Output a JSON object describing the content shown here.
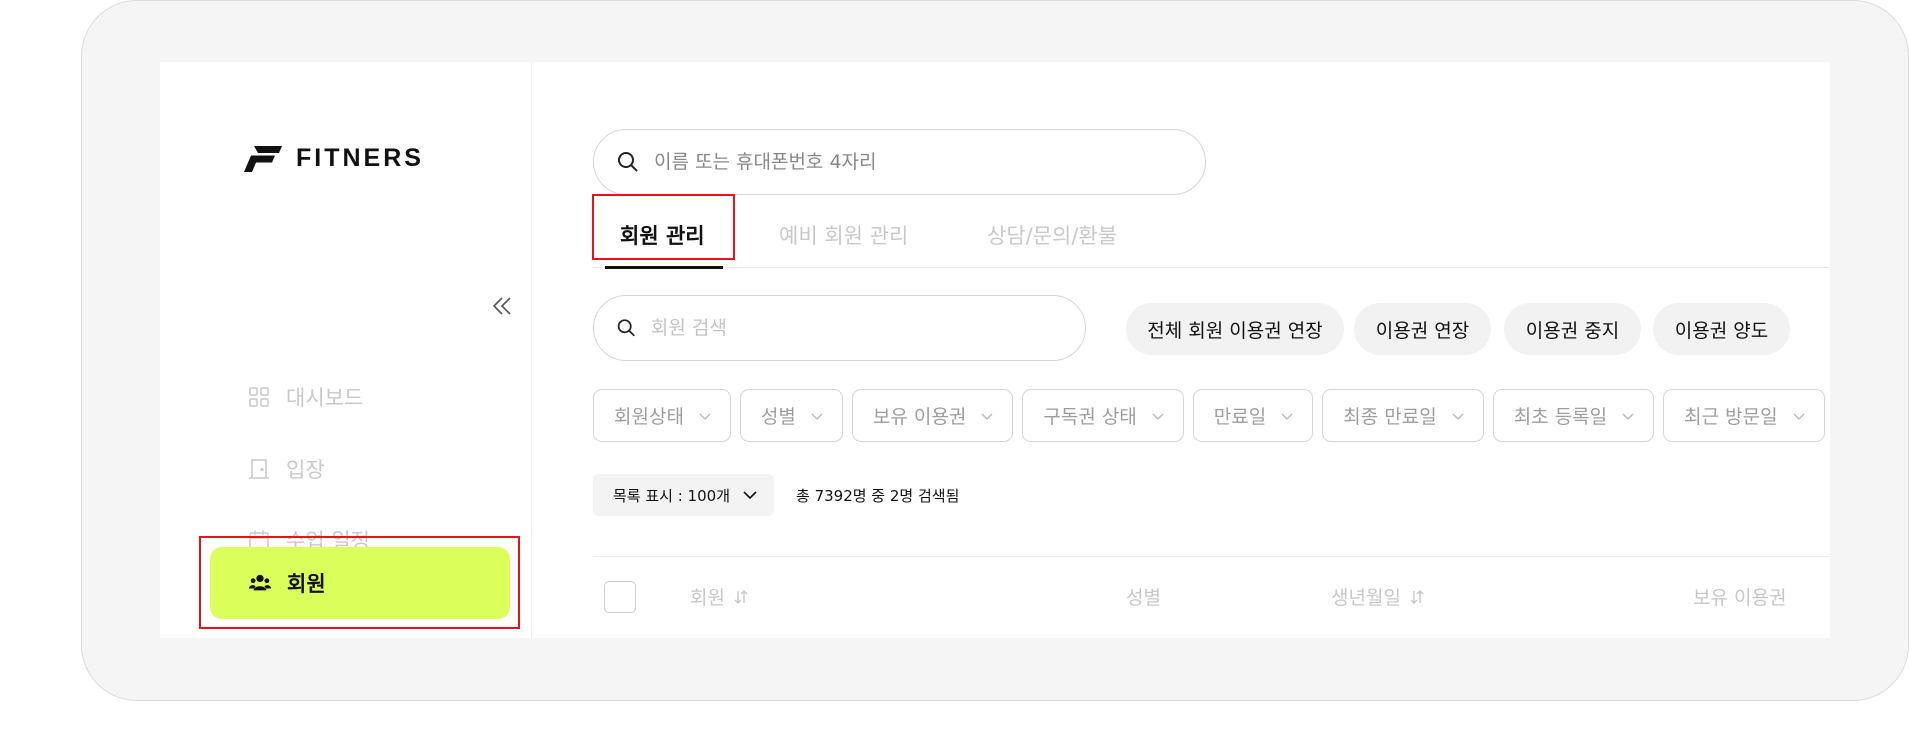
{
  "brand": {
    "name": "FITNERS"
  },
  "sidebar": {
    "items": [
      {
        "label": "대시보드",
        "icon": "grid-icon"
      },
      {
        "label": "입장",
        "icon": "door-icon"
      },
      {
        "label": "수업 일정",
        "icon": "calendar-icon"
      },
      {
        "label": "회원",
        "icon": "members-icon",
        "active": true
      }
    ]
  },
  "top_search": {
    "placeholder": "이름 또는 휴대폰번호 4자리"
  },
  "tabs": [
    {
      "label": "회원 관리",
      "active": true
    },
    {
      "label": "예비 회원 관리"
    },
    {
      "label": "상담/문의/환불"
    }
  ],
  "member_search": {
    "placeholder": "회원 검색"
  },
  "actions": {
    "extend_all": "전체 회원 이용권 연장",
    "extend": "이용권 연장",
    "pause": "이용권 중지",
    "transfer": "이용권 양도"
  },
  "filters": [
    "회원상태",
    "성별",
    "보유 이용권",
    "구독권 상태",
    "만료일",
    "최종 만료일",
    "최초 등록일",
    "최근 방문일"
  ],
  "list": {
    "page_size_label": "목록 표시 : 100개",
    "result_count": "총 7392명 중 2명 검색됨"
  },
  "table": {
    "columns": [
      "회원",
      "성별",
      "생년월일",
      "보유 이용권"
    ]
  },
  "colors": {
    "accent": "#dbff5a",
    "highlight": "#e8121d"
  }
}
